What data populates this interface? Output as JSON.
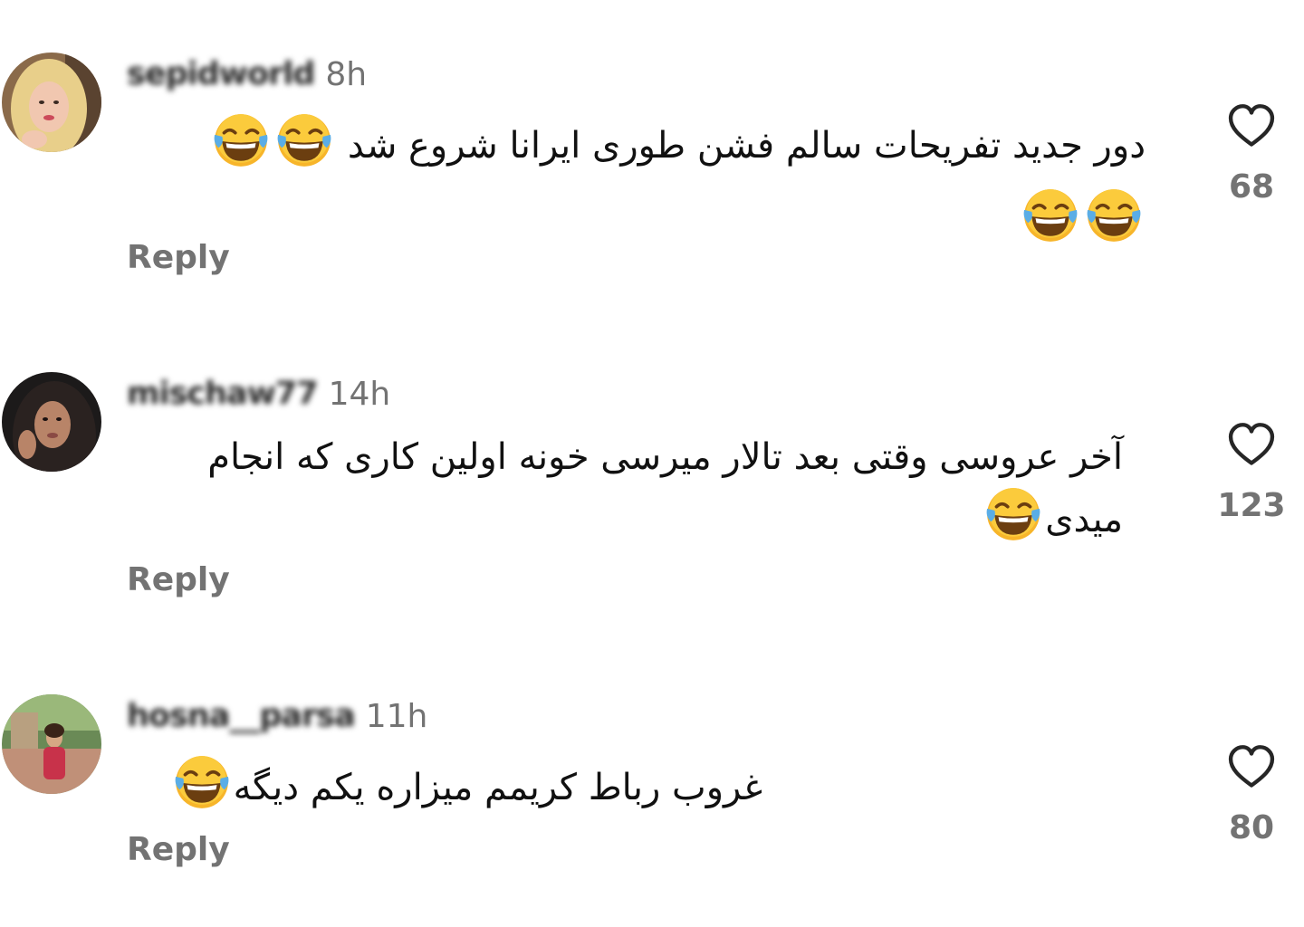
{
  "comments": [
    {
      "username": "sepidworld",
      "time": "8h",
      "text": "دور جدید تفریحات سالم فشن طوری ایرانا شروع شد",
      "emoji": "😂",
      "likes": "68",
      "reply_label": "Reply"
    },
    {
      "username": "mischaw77",
      "time": "14h",
      "text_line1": "آخر عروسی وقتی بعد تالار میرسی خونه اولین کاری که انجام",
      "text_line2": "میدی",
      "emoji": "😂",
      "likes": "123",
      "reply_label": "Reply"
    },
    {
      "username": "hosna__parsa",
      "time": "11h",
      "text": "غروب رباط کریمم میزاره یکم دیگه",
      "emoji": "😂",
      "likes": "80",
      "reply_label": "Reply"
    }
  ],
  "icons": {
    "like": "heart-icon",
    "emoji": "face-with-tears-of-joy"
  },
  "colors": {
    "text": "#111111",
    "secondary": "#737373",
    "emoji_yellow": "#F7B52A",
    "emoji_tear": "#5AADE6"
  }
}
